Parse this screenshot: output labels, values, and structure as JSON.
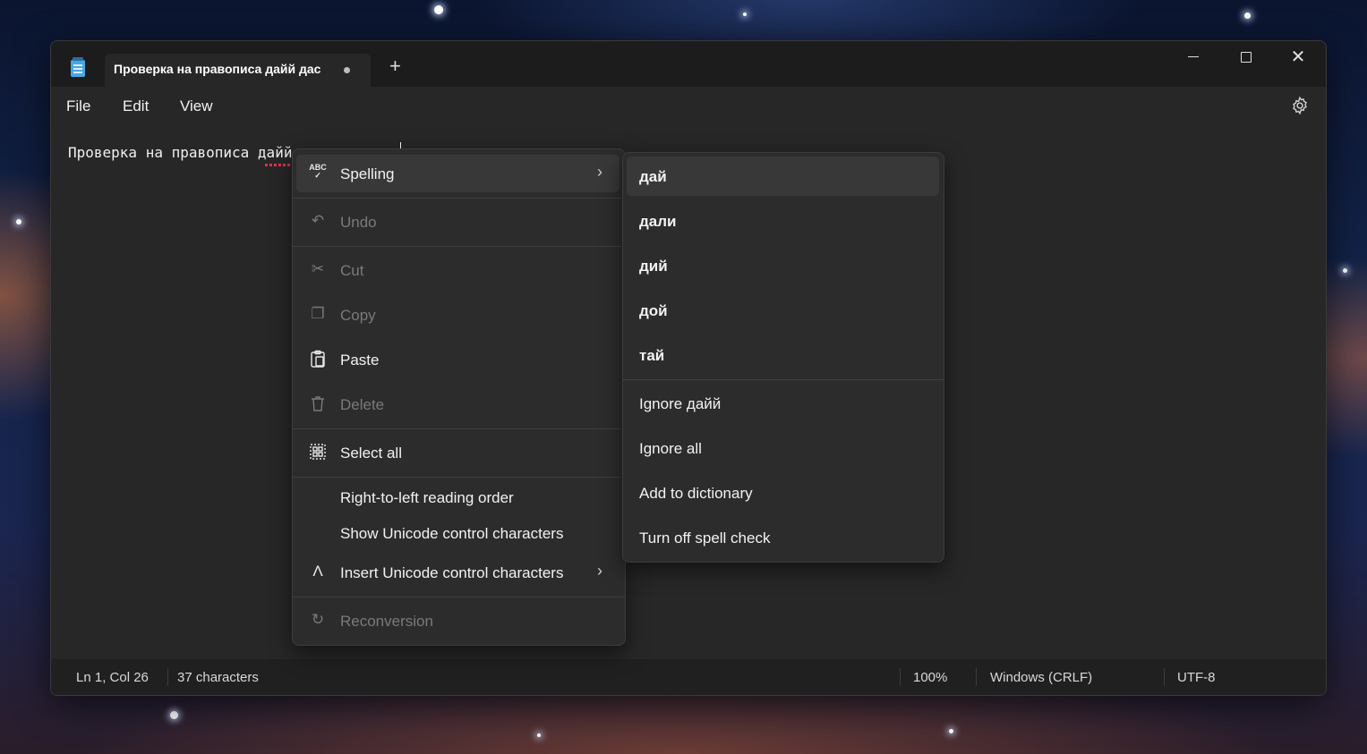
{
  "window": {
    "tab_title": "Проверка на правописа дайй дас",
    "new_tab": "+",
    "minimize": "",
    "maximize": "",
    "close": "✕"
  },
  "menubar": {
    "file": "File",
    "edit": "Edit",
    "view": "View"
  },
  "editor": {
    "text": "Проверка на правописа дайй дааа дааа"
  },
  "status": {
    "position": "Ln 1, Col 26",
    "characters": "37 characters",
    "zoom": "100%",
    "line_ending": "Windows (CRLF)",
    "encoding": "UTF-8"
  },
  "context_menu": {
    "spelling": "Spelling",
    "undo": "Undo",
    "cut": "Cut",
    "copy": "Copy",
    "paste": "Paste",
    "delete": "Delete",
    "select_all": "Select all",
    "rtl": "Right-to-left reading order",
    "show_unicode": "Show Unicode control characters",
    "insert_unicode": "Insert Unicode control characters",
    "reconversion": "Reconversion",
    "spelling_icon_text": "ABC"
  },
  "spelling_menu": {
    "suggestions": [
      "дай",
      "дали",
      "дий",
      "дой",
      "тай"
    ],
    "ignore": "Ignore дайй",
    "ignore_all": "Ignore all",
    "add_dictionary": "Add to dictionary",
    "turn_off": "Turn off spell check"
  }
}
